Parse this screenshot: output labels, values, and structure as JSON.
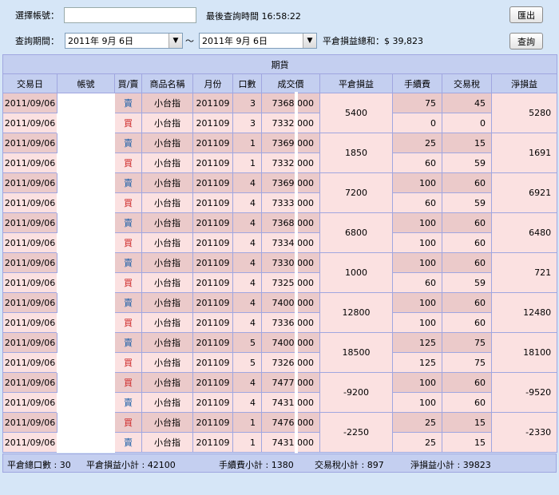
{
  "header": {
    "account_label": "選擇帳號：",
    "account_value": "",
    "last_query_label": "最後查詢時間 16:58:22",
    "export_label": "匯出",
    "period_label": "查詢期間：",
    "start_date": "2011年  9月  6日",
    "tilde": "～",
    "end_date": "2011年  9月  6日",
    "pnl_total_label": "平倉損益總和：$ 39,823",
    "query_label": "查詢"
  },
  "table": {
    "caption": "期貨",
    "columns": [
      "交易日",
      "帳號",
      "買/賣",
      "商品名稱",
      "月份",
      "口數",
      "成交價",
      "平倉損益",
      "手續費",
      "交易稅",
      "淨損益"
    ],
    "groups": [
      {
        "pnl": "5400",
        "net": "5280",
        "rows": [
          {
            "date": "2011/09/06",
            "side": "賣",
            "side_type": "sell",
            "product": "小台指",
            "month": "201109",
            "qty": "3",
            "price": "7368.000",
            "fee": "75",
            "tax": "45"
          },
          {
            "date": "2011/09/06",
            "side": "買",
            "side_type": "buy",
            "product": "小台指",
            "month": "201109",
            "qty": "3",
            "price": "7332.000",
            "fee": "0",
            "tax": "0"
          }
        ]
      },
      {
        "pnl": "1850",
        "net": "1691",
        "rows": [
          {
            "date": "2011/09/06",
            "side": "賣",
            "side_type": "sell",
            "product": "小台指",
            "month": "201109",
            "qty": "1",
            "price": "7369.000",
            "fee": "25",
            "tax": "15"
          },
          {
            "date": "2011/09/06",
            "side": "買",
            "side_type": "buy",
            "product": "小台指",
            "month": "201109",
            "qty": "1",
            "price": "7332.000",
            "fee": "60",
            "tax": "59"
          }
        ]
      },
      {
        "pnl": "7200",
        "net": "6921",
        "rows": [
          {
            "date": "2011/09/06",
            "side": "賣",
            "side_type": "sell",
            "product": "小台指",
            "month": "201109",
            "qty": "4",
            "price": "7369.000",
            "fee": "100",
            "tax": "60"
          },
          {
            "date": "2011/09/06",
            "side": "買",
            "side_type": "buy",
            "product": "小台指",
            "month": "201109",
            "qty": "4",
            "price": "7333.000",
            "fee": "60",
            "tax": "59"
          }
        ]
      },
      {
        "pnl": "6800",
        "net": "6480",
        "rows": [
          {
            "date": "2011/09/06",
            "side": "賣",
            "side_type": "sell",
            "product": "小台指",
            "month": "201109",
            "qty": "4",
            "price": "7368.000",
            "fee": "100",
            "tax": "60"
          },
          {
            "date": "2011/09/06",
            "side": "買",
            "side_type": "buy",
            "product": "小台指",
            "month": "201109",
            "qty": "4",
            "price": "7334.000",
            "fee": "100",
            "tax": "60"
          }
        ]
      },
      {
        "pnl": "1000",
        "net": "721",
        "rows": [
          {
            "date": "2011/09/06",
            "side": "賣",
            "side_type": "sell",
            "product": "小台指",
            "month": "201109",
            "qty": "4",
            "price": "7330.000",
            "fee": "100",
            "tax": "60"
          },
          {
            "date": "2011/09/06",
            "side": "買",
            "side_type": "buy",
            "product": "小台指",
            "month": "201109",
            "qty": "4",
            "price": "7325.000",
            "fee": "60",
            "tax": "59"
          }
        ]
      },
      {
        "pnl": "12800",
        "net": "12480",
        "rows": [
          {
            "date": "2011/09/06",
            "side": "賣",
            "side_type": "sell",
            "product": "小台指",
            "month": "201109",
            "qty": "4",
            "price": "7400.000",
            "fee": "100",
            "tax": "60"
          },
          {
            "date": "2011/09/06",
            "side": "買",
            "side_type": "buy",
            "product": "小台指",
            "month": "201109",
            "qty": "4",
            "price": "7336.000",
            "fee": "100",
            "tax": "60"
          }
        ]
      },
      {
        "pnl": "18500",
        "net": "18100",
        "rows": [
          {
            "date": "2011/09/06",
            "side": "賣",
            "side_type": "sell",
            "product": "小台指",
            "month": "201109",
            "qty": "5",
            "price": "7400.000",
            "fee": "125",
            "tax": "75"
          },
          {
            "date": "2011/09/06",
            "side": "買",
            "side_type": "buy",
            "product": "小台指",
            "month": "201109",
            "qty": "5",
            "price": "7326.000",
            "fee": "125",
            "tax": "75"
          }
        ]
      },
      {
        "pnl": "-9200",
        "net": "-9520",
        "rows": [
          {
            "date": "2011/09/06",
            "side": "買",
            "side_type": "buy",
            "product": "小台指",
            "month": "201109",
            "qty": "4",
            "price": "7477.000",
            "fee": "100",
            "tax": "60"
          },
          {
            "date": "2011/09/06",
            "side": "賣",
            "side_type": "sell",
            "product": "小台指",
            "month": "201109",
            "qty": "4",
            "price": "7431.000",
            "fee": "100",
            "tax": "60"
          }
        ]
      },
      {
        "pnl": "-2250",
        "net": "-2330",
        "rows": [
          {
            "date": "2011/09/06",
            "side": "買",
            "side_type": "buy",
            "product": "小台指",
            "month": "201109",
            "qty": "1",
            "price": "7476.000",
            "fee": "25",
            "tax": "15"
          },
          {
            "date": "2011/09/06",
            "side": "賣",
            "side_type": "sell",
            "product": "小台指",
            "month": "201109",
            "qty": "1",
            "price": "7431.000",
            "fee": "25",
            "tax": "15"
          }
        ]
      }
    ]
  },
  "footer": {
    "total_qty": "平倉總口數 : 30",
    "pnl_subtotal": "平倉損益小計 : 42100",
    "fee_subtotal": "手續費小計 : 1380",
    "tax_subtotal": "交易稅小計 : 897",
    "net_subtotal": "淨損益小計 : 39823"
  },
  "colors": {
    "background": "#d6e6f7",
    "header_row": "#c4cff0",
    "row_light": "#fbe1e1",
    "row_dark": "#ebcaca",
    "sell_text": "#1a5fa8",
    "buy_text": "#cc2222"
  }
}
